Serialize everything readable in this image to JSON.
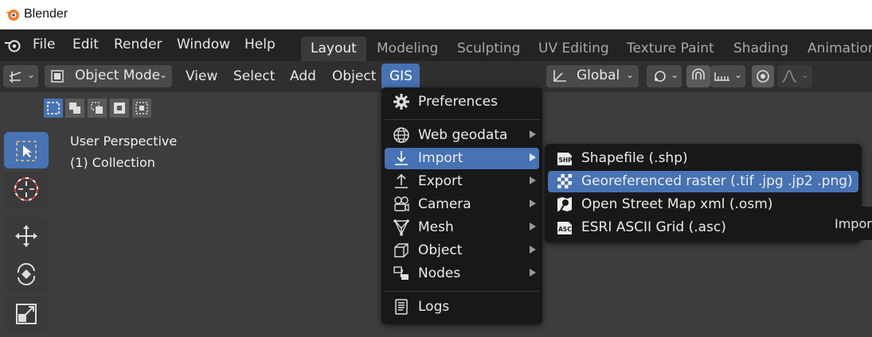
{
  "window": {
    "title": "Blender"
  },
  "topbar": {
    "menus": [
      "File",
      "Edit",
      "Render",
      "Window",
      "Help"
    ],
    "workspace_tabs": [
      "Layout",
      "Modeling",
      "Sculpting",
      "UV Editing",
      "Texture Paint",
      "Shading",
      "Animation"
    ],
    "active_tab": "Layout"
  },
  "header": {
    "mode_label": "Object Mode",
    "menus": [
      "View",
      "Select",
      "Add",
      "Object",
      "GIS"
    ],
    "transform_orientation": "Global"
  },
  "viewport": {
    "perspective_label": "User Perspective",
    "collection_label": "(1) Collection"
  },
  "gis_menu": {
    "items": [
      {
        "label": "Preferences",
        "icon": "gear-icon",
        "submenu": false
      },
      {
        "label": "Web geodata",
        "icon": "globe-icon",
        "submenu": true
      },
      {
        "label": "Import",
        "icon": "import-icon",
        "submenu": true,
        "highlighted": true
      },
      {
        "label": "Export",
        "icon": "export-icon",
        "submenu": true
      },
      {
        "label": "Camera",
        "icon": "camera-icon",
        "submenu": true
      },
      {
        "label": "Mesh",
        "icon": "mesh-icon",
        "submenu": true
      },
      {
        "label": "Object",
        "icon": "cube-icon",
        "submenu": true
      },
      {
        "label": "Nodes",
        "icon": "nodes-icon",
        "submenu": true
      },
      {
        "label": "Logs",
        "icon": "text-icon",
        "submenu": false
      }
    ]
  },
  "import_submenu": {
    "items": [
      {
        "label": "Shapefile (.shp)",
        "icon": "shp-icon"
      },
      {
        "label": "Georeferenced raster (.tif .jpg .jp2 .png)",
        "icon": "raster-icon",
        "highlighted": true
      },
      {
        "label": "Open Street Map xml (.osm)",
        "icon": "osm-icon"
      },
      {
        "label": "ESRI ASCII Grid (.asc)",
        "icon": "asc-icon"
      }
    ]
  },
  "tooltip": {
    "text": "Impor"
  },
  "colors": {
    "accent": "#4772b3",
    "menu_bg": "#181818",
    "viewport_bg": "#3d3d3d"
  }
}
